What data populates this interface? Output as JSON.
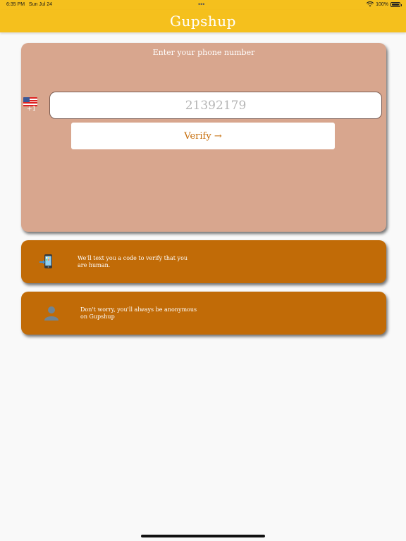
{
  "status_bar": {
    "time": "6:35 PM",
    "date": "Sun Jul 24",
    "dots": "•••",
    "battery": "100%"
  },
  "header": {
    "title": "Gupshup"
  },
  "phone_card": {
    "prompt": "Enter your phone number",
    "country_code": "+1",
    "phone_value": "21392179",
    "verify_label": "Verify →"
  },
  "info": {
    "code_text": "We'll text you a code to verify that you are human.",
    "anonymous_text": "Don't worry, you'll always be anonymous on Gupshup"
  },
  "colors": {
    "header": "#f5c01d",
    "phone_card": "#d8a68e",
    "info_card": "#c16b07",
    "verify_text": "#c56b07"
  },
  "icons": [
    "wifi-icon",
    "battery-icon",
    "us-flag-icon",
    "phone-icon",
    "person-icon"
  ]
}
